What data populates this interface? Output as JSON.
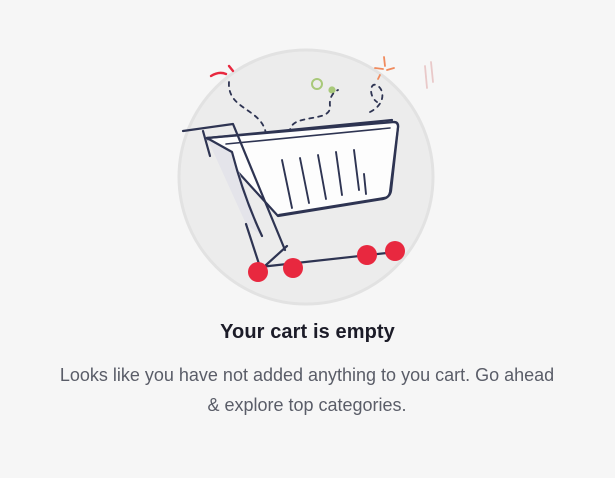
{
  "empty_state": {
    "title": "Your cart is empty",
    "message": "Looks like you have not added anything to you cart. Go ahead & explore top categories.",
    "illustration_icon": "shopping-cart-icon"
  },
  "colors": {
    "background": "#f6f6f6",
    "title": "#1c1c28",
    "message": "#5a5d68",
    "accent_red": "#e8283f",
    "line_navy": "#2e3452",
    "circle_fill": "#ececec",
    "accent_orange": "#f08a5d",
    "accent_green": "#a9c97a"
  }
}
